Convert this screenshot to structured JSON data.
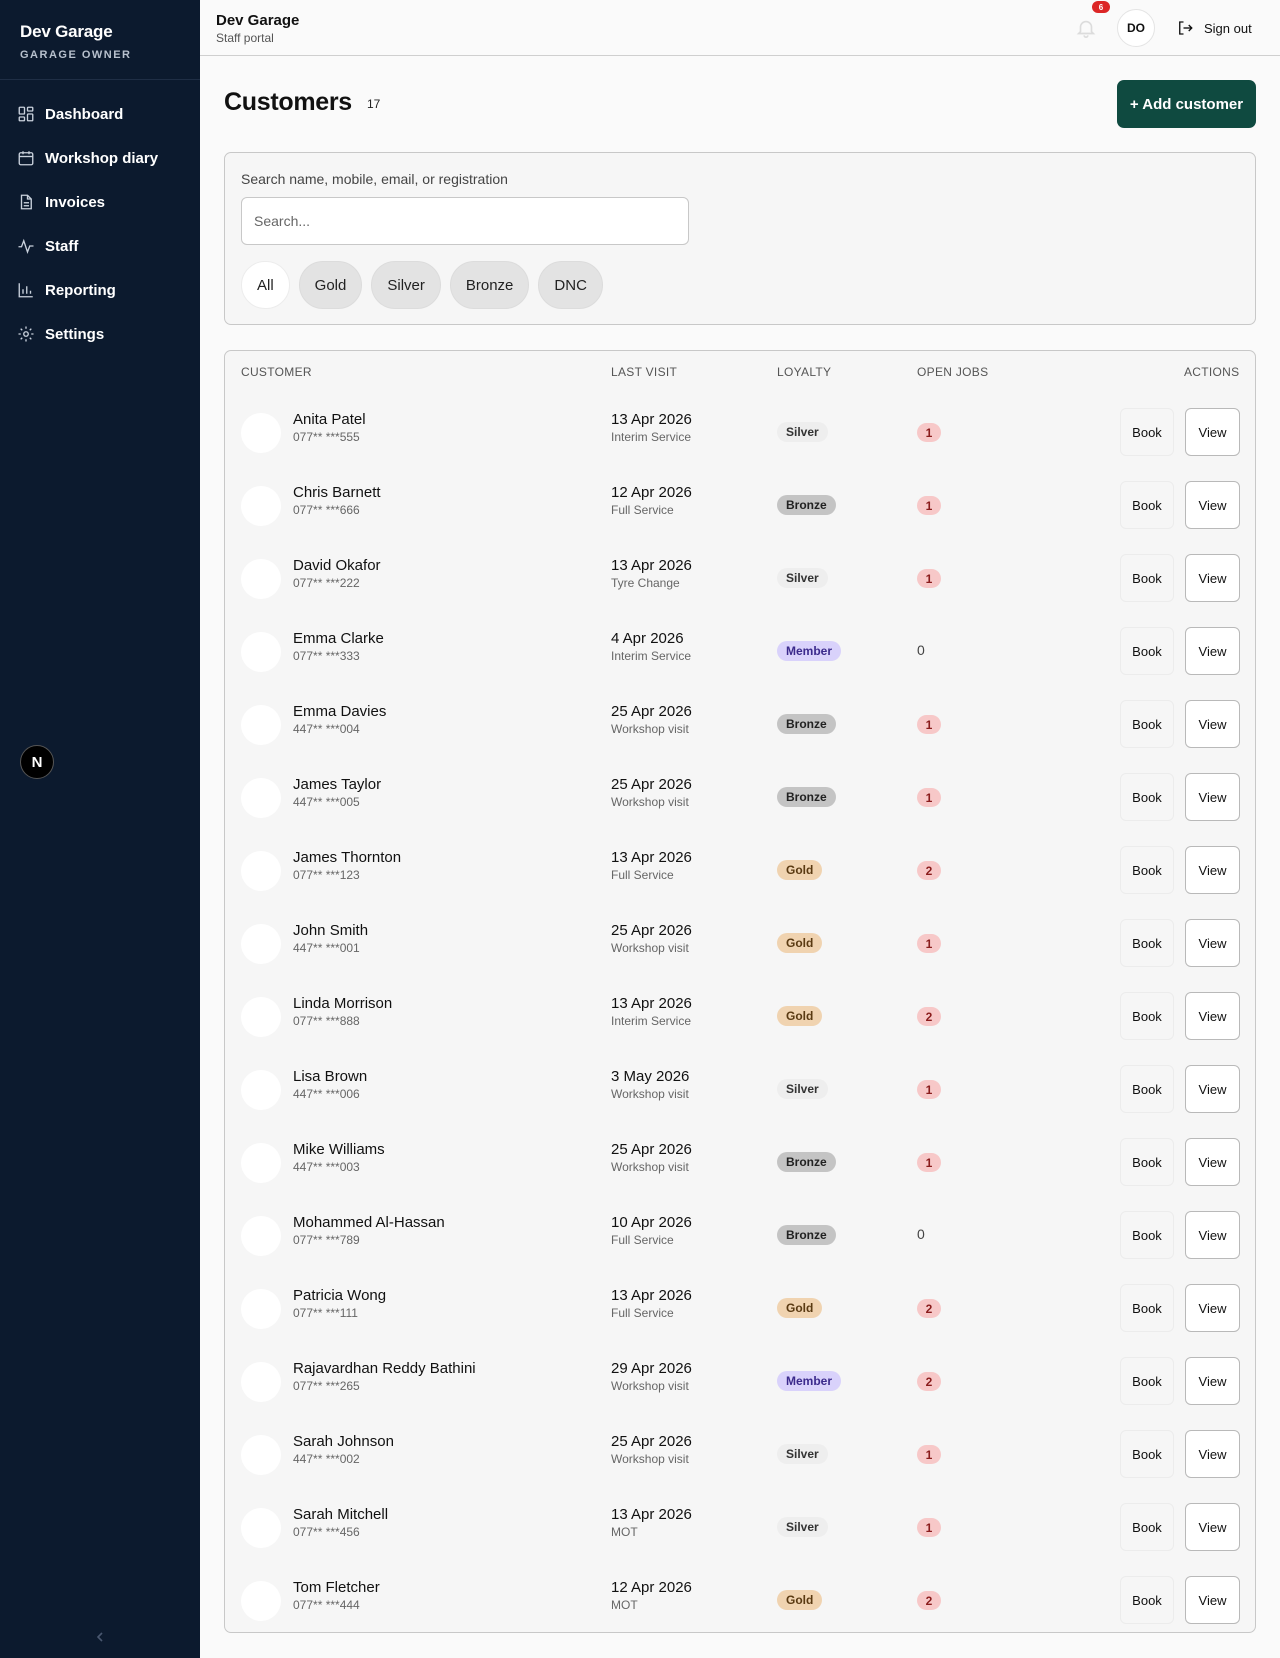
{
  "sidebar": {
    "brand_name": "Dev Garage",
    "brand_role": "GARAGE OWNER",
    "items": [
      {
        "label": "Dashboard",
        "icon": "grid-icon"
      },
      {
        "label": "Workshop diary",
        "icon": "calendar-icon"
      },
      {
        "label": "Invoices",
        "icon": "document-icon"
      },
      {
        "label": "Staff",
        "icon": "activity-icon"
      },
      {
        "label": "Reporting",
        "icon": "bar-chart-icon"
      },
      {
        "label": "Settings",
        "icon": "gear-icon"
      }
    ],
    "badge_letter": "N"
  },
  "topbar": {
    "title": "Dev Garage",
    "subtitle": "Staff portal",
    "notification_count": "6",
    "avatar_initials": "DO",
    "signout_label": "Sign out"
  },
  "page": {
    "title": "Customers",
    "count": "17",
    "add_button": "+ Add customer"
  },
  "search": {
    "label": "Search name, mobile, email, or registration",
    "placeholder": "Search...",
    "value": "",
    "filters": [
      "All",
      "Gold",
      "Silver",
      "Bronze",
      "DNC"
    ],
    "active_filter": "All"
  },
  "table": {
    "headers": {
      "customer": "CUSTOMER",
      "last_visit": "LAST VISIT",
      "loyalty": "LOYALTY",
      "open_jobs": "OPEN JOBS",
      "actions": "ACTIONS"
    },
    "book_label": "Book",
    "view_label": "View",
    "rows": [
      {
        "name": "Anita Patel",
        "phone": "077** ***555",
        "date": "13 Apr 2026",
        "service": "Interim Service",
        "loyalty": "Silver",
        "jobs": "1"
      },
      {
        "name": "Chris Barnett",
        "phone": "077** ***666",
        "date": "12 Apr 2026",
        "service": "Full Service",
        "loyalty": "Bronze",
        "jobs": "1"
      },
      {
        "name": "David Okafor",
        "phone": "077** ***222",
        "date": "13 Apr 2026",
        "service": "Tyre Change",
        "loyalty": "Silver",
        "jobs": "1"
      },
      {
        "name": "Emma Clarke",
        "phone": "077** ***333",
        "date": "4 Apr 2026",
        "service": "Interim Service",
        "loyalty": "Member",
        "jobs": "0"
      },
      {
        "name": "Emma Davies",
        "phone": "447** ***004",
        "date": "25 Apr 2026",
        "service": "Workshop visit",
        "loyalty": "Bronze",
        "jobs": "1"
      },
      {
        "name": "James Taylor",
        "phone": "447** ***005",
        "date": "25 Apr 2026",
        "service": "Workshop visit",
        "loyalty": "Bronze",
        "jobs": "1"
      },
      {
        "name": "James Thornton",
        "phone": "077** ***123",
        "date": "13 Apr 2026",
        "service": "Full Service",
        "loyalty": "Gold",
        "jobs": "2"
      },
      {
        "name": "John Smith",
        "phone": "447** ***001",
        "date": "25 Apr 2026",
        "service": "Workshop visit",
        "loyalty": "Gold",
        "jobs": "1"
      },
      {
        "name": "Linda Morrison",
        "phone": "077** ***888",
        "date": "13 Apr 2026",
        "service": "Interim Service",
        "loyalty": "Gold",
        "jobs": "2"
      },
      {
        "name": "Lisa Brown",
        "phone": "447** ***006",
        "date": "3 May 2026",
        "service": "Workshop visit",
        "loyalty": "Silver",
        "jobs": "1"
      },
      {
        "name": "Mike Williams",
        "phone": "447** ***003",
        "date": "25 Apr 2026",
        "service": "Workshop visit",
        "loyalty": "Bronze",
        "jobs": "1"
      },
      {
        "name": "Mohammed Al-Hassan",
        "phone": "077** ***789",
        "date": "10 Apr 2026",
        "service": "Full Service",
        "loyalty": "Bronze",
        "jobs": "0"
      },
      {
        "name": "Patricia Wong",
        "phone": "077** ***111",
        "date": "13 Apr 2026",
        "service": "Full Service",
        "loyalty": "Gold",
        "jobs": "2"
      },
      {
        "name": "Rajavardhan Reddy Bathini",
        "phone": "077** ***265",
        "date": "29 Apr 2026",
        "service": "Workshop visit",
        "loyalty": "Member",
        "jobs": "2"
      },
      {
        "name": "Sarah Johnson",
        "phone": "447** ***002",
        "date": "25 Apr 2026",
        "service": "Workshop visit",
        "loyalty": "Silver",
        "jobs": "1"
      },
      {
        "name": "Sarah Mitchell",
        "phone": "077** ***456",
        "date": "13 Apr 2026",
        "service": "MOT",
        "loyalty": "Silver",
        "jobs": "1"
      },
      {
        "name": "Tom Fletcher",
        "phone": "077** ***444",
        "date": "12 Apr 2026",
        "service": "MOT",
        "loyalty": "Gold",
        "jobs": "2"
      }
    ]
  },
  "colors": {
    "sidebar_bg": "#0c1a2e",
    "accent": "#0f4a40",
    "gold": "#f0d3b0",
    "silver": "#eeeeee",
    "bronze": "#c4c4c4",
    "member": "#d9d2fb",
    "jobs_badge": "#f7c8c8"
  }
}
